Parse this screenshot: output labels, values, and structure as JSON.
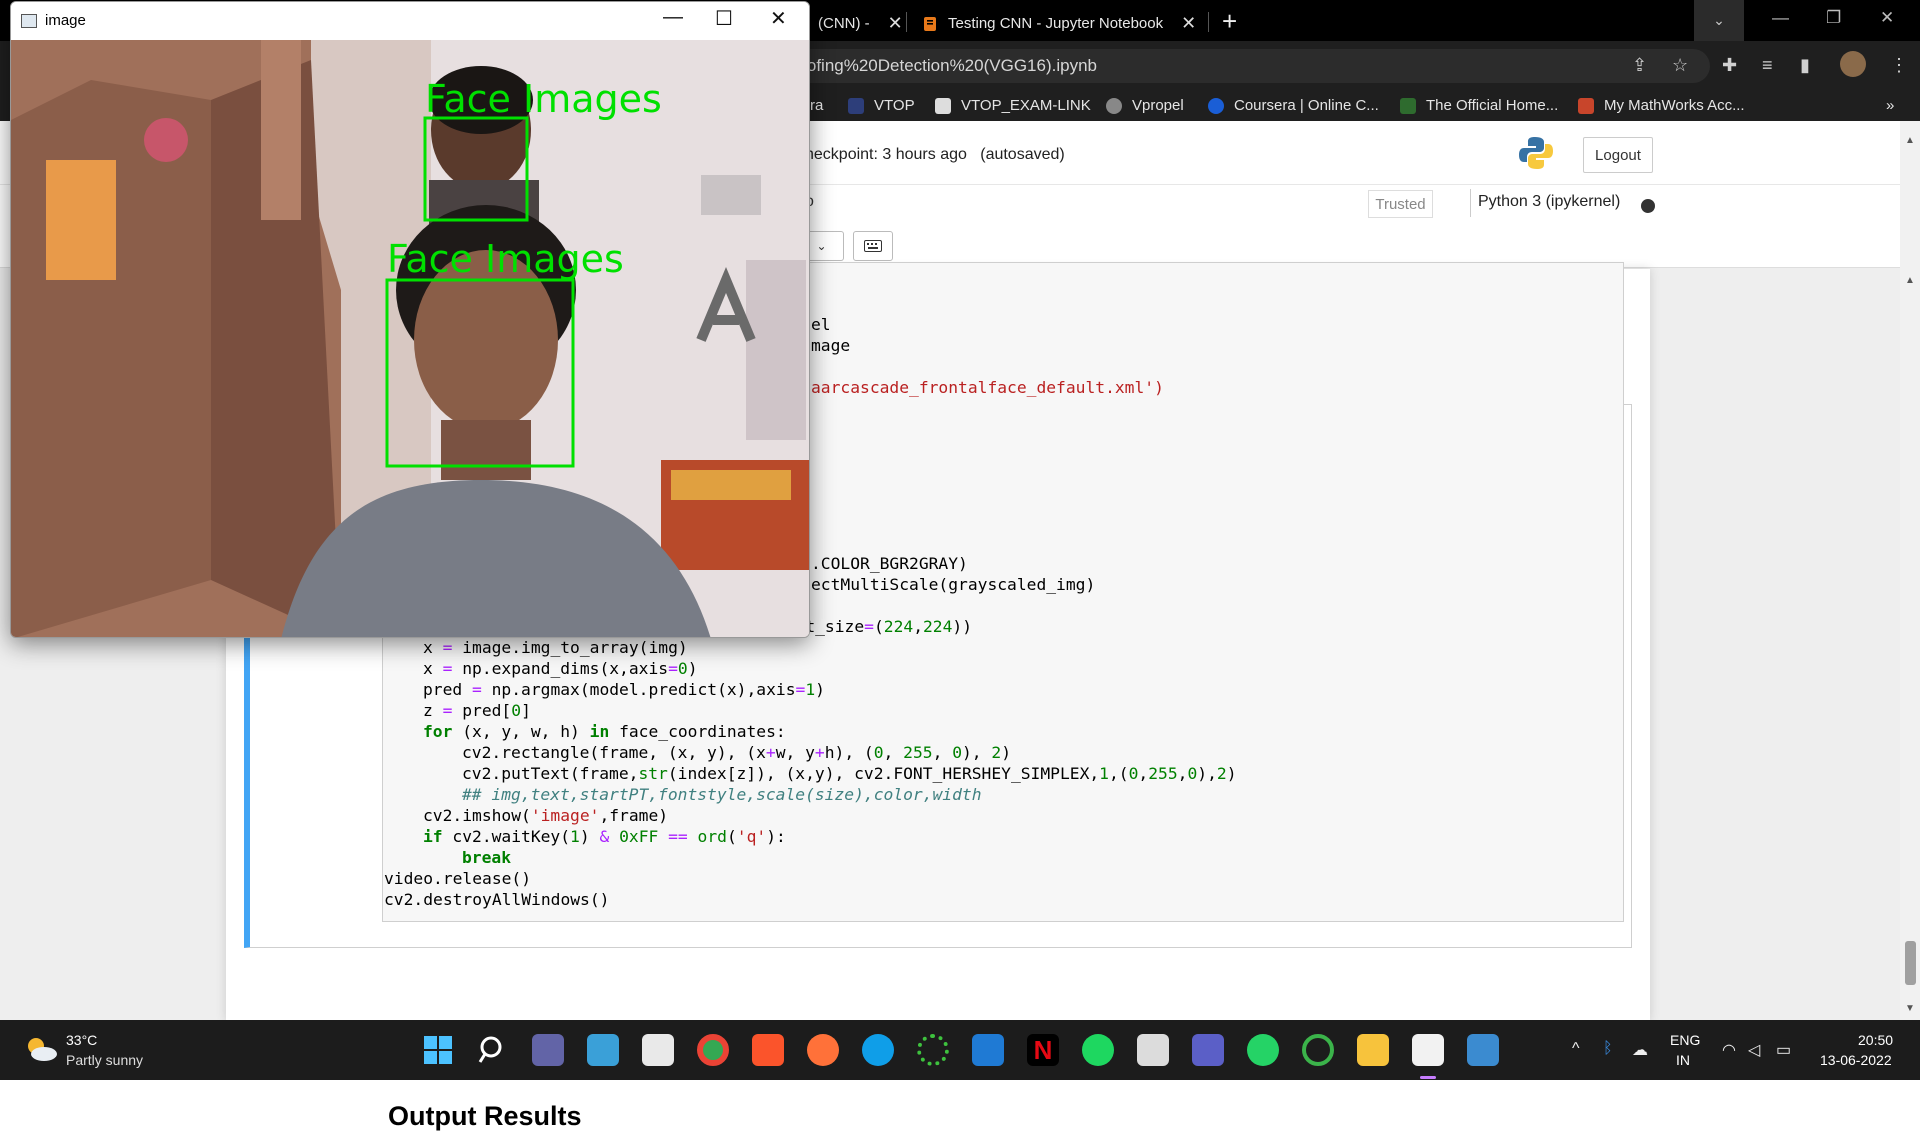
{
  "browser": {
    "tabs": [
      {
        "title": "(CNN) -"
      },
      {
        "title": "Testing CNN - Jupyter Notebook"
      }
    ],
    "address": "0spoofing%20Detection%20(VGG16).ipynb",
    "bookmarks": [
      {
        "label": "ra"
      },
      {
        "label": "VTOP"
      },
      {
        "label": "VTOP_EXAM-LINK"
      },
      {
        "label": "Vpropel"
      },
      {
        "label": "Coursera | Online C..."
      },
      {
        "label": "The Official Home..."
      },
      {
        "label": "My MathWorks Acc..."
      }
    ],
    "more": "»"
  },
  "jupyter": {
    "checkpoint": "heckpoint: 3 hours ago",
    "autosaved": "(autosaved)",
    "logout": "Logout",
    "menu_fragment": "o",
    "trusted": "Trusted",
    "kernel": "Python 3 (ipykernel)",
    "output_heading": "Output Results"
  },
  "code_lines_partial": [
    "el",
    "mage",
    "aarcascade_frontalface_default.xml')",
    ".COLOR_BGR2GRAY)",
    "ectMultiScale(grayscaled_img)"
  ],
  "cv_window": {
    "title": "image",
    "label1": "Face Images",
    "label2": "Face Images"
  },
  "taskbar": {
    "temp": "33°C",
    "weather": "Partly sunny",
    "lang1": "ENG",
    "lang2": "IN",
    "time": "20:50",
    "date": "13-06-2022"
  }
}
